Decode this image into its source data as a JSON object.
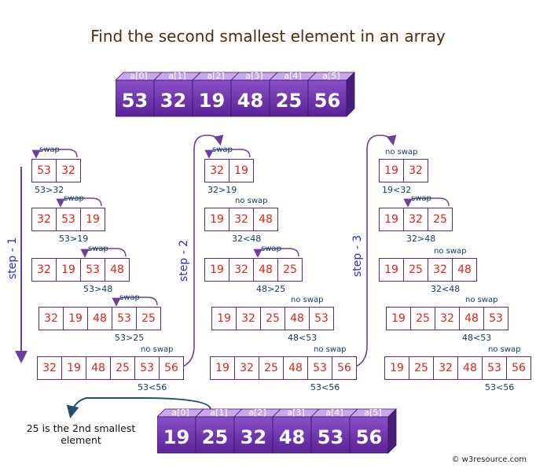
{
  "title": "Find the second smallest element in an array",
  "top_array": {
    "indices": [
      "a[0]",
      "a[1]",
      "a[2]",
      "a[3]",
      "a[4]",
      "a[5]"
    ],
    "values": [
      "53",
      "32",
      "19",
      "48",
      "25",
      "56"
    ]
  },
  "bottom_array": {
    "indices": [
      "a[0]",
      "a[1]",
      "a[2]",
      "a[3]",
      "a[4]",
      "a[5]"
    ],
    "values": [
      "19",
      "25",
      "32",
      "48",
      "53",
      "56"
    ]
  },
  "step_labels": [
    "step - 1",
    "step - 2",
    "step - 3"
  ],
  "steps": [
    {
      "rows": [
        {
          "cells": [
            "53",
            "32"
          ],
          "tag": "swap",
          "cond": "53>32"
        },
        {
          "cells": [
            "32",
            "53",
            "19"
          ],
          "tag": "swap",
          "cond": "53>19"
        },
        {
          "cells": [
            "32",
            "19",
            "53",
            "48"
          ],
          "tag": "swap",
          "cond": "53>48"
        },
        {
          "cells": [
            "32",
            "19",
            "48",
            "53",
            "25"
          ],
          "tag": "swap",
          "cond": "53>25"
        },
        {
          "cells": [
            "32",
            "19",
            "48",
            "25",
            "53",
            "56"
          ],
          "tag": "no swap",
          "cond": "53<56"
        }
      ]
    },
    {
      "rows": [
        {
          "cells": [
            "32",
            "19"
          ],
          "tag": "swap",
          "cond": "32>19"
        },
        {
          "cells": [
            "19",
            "32",
            "48"
          ],
          "tag": "no swap",
          "cond": "32<48"
        },
        {
          "cells": [
            "19",
            "32",
            "48",
            "25"
          ],
          "tag": "swap",
          "cond": "48>25"
        },
        {
          "cells": [
            "19",
            "32",
            "25",
            "48",
            "53"
          ],
          "tag": "no swap",
          "cond": "48<53"
        },
        {
          "cells": [
            "19",
            "32",
            "25",
            "48",
            "53",
            "56"
          ],
          "tag": "no swap",
          "cond": "53<56"
        }
      ]
    },
    {
      "rows": [
        {
          "cells": [
            "19",
            "32"
          ],
          "tag": "no swap",
          "cond": "19<32"
        },
        {
          "cells": [
            "19",
            "32",
            "25"
          ],
          "tag": "swap",
          "cond": "32>48"
        },
        {
          "cells": [
            "19",
            "25",
            "32",
            "48"
          ],
          "tag": "no swap",
          "cond": "32<48"
        },
        {
          "cells": [
            "19",
            "25",
            "32",
            "48",
            "53"
          ],
          "tag": "no swap",
          "cond": "48<53"
        },
        {
          "cells": [
            "19",
            "25",
            "32",
            "48",
            "53",
            "56"
          ],
          "tag": "no swap",
          "cond": "53<56"
        }
      ]
    }
  ],
  "result_text": "25 is the 2nd smallest element",
  "credit": "© w3resource.com",
  "colors": {
    "cube_front": "#6a2fa3",
    "cube_top": "#c9a7ea",
    "cube_side": "#4a1d7a",
    "cell_border": "#5a2b82",
    "cell_text": "#e2231a",
    "arrow": "#6b3fa0",
    "step_text": "#2b2bc9"
  }
}
